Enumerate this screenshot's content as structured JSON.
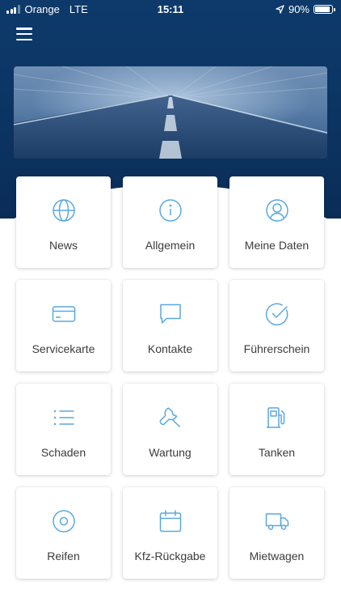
{
  "status_bar": {
    "carrier": "Orange",
    "network": "LTE",
    "time": "15:11",
    "battery": "90%",
    "battery_level": 0.9
  },
  "colors": {
    "header": "#0c3462",
    "icon": "#5aa9de",
    "label": "#3c3c3c"
  },
  "header": {
    "menu_icon": "hamburger-icon",
    "banner": "road-image"
  },
  "tiles": [
    {
      "label": "News",
      "icon": "globe-icon"
    },
    {
      "label": "Allgemein",
      "icon": "info-icon"
    },
    {
      "label": "Meine Daten",
      "icon": "user-icon"
    },
    {
      "label": "Servicekarte",
      "icon": "credit-card-icon"
    },
    {
      "label": "Kontakte",
      "icon": "chat-icon"
    },
    {
      "label": "Führerschein",
      "icon": "check-circle-icon"
    },
    {
      "label": "Schaden",
      "icon": "list-icon"
    },
    {
      "label": "Wartung",
      "icon": "wrench-icon"
    },
    {
      "label": "Tanken",
      "icon": "fuel-icon"
    },
    {
      "label": "Reifen",
      "icon": "tire-icon"
    },
    {
      "label": "Kfz-Rückgabe",
      "icon": "calendar-icon"
    },
    {
      "label": "Mietwagen",
      "icon": "truck-icon"
    }
  ]
}
